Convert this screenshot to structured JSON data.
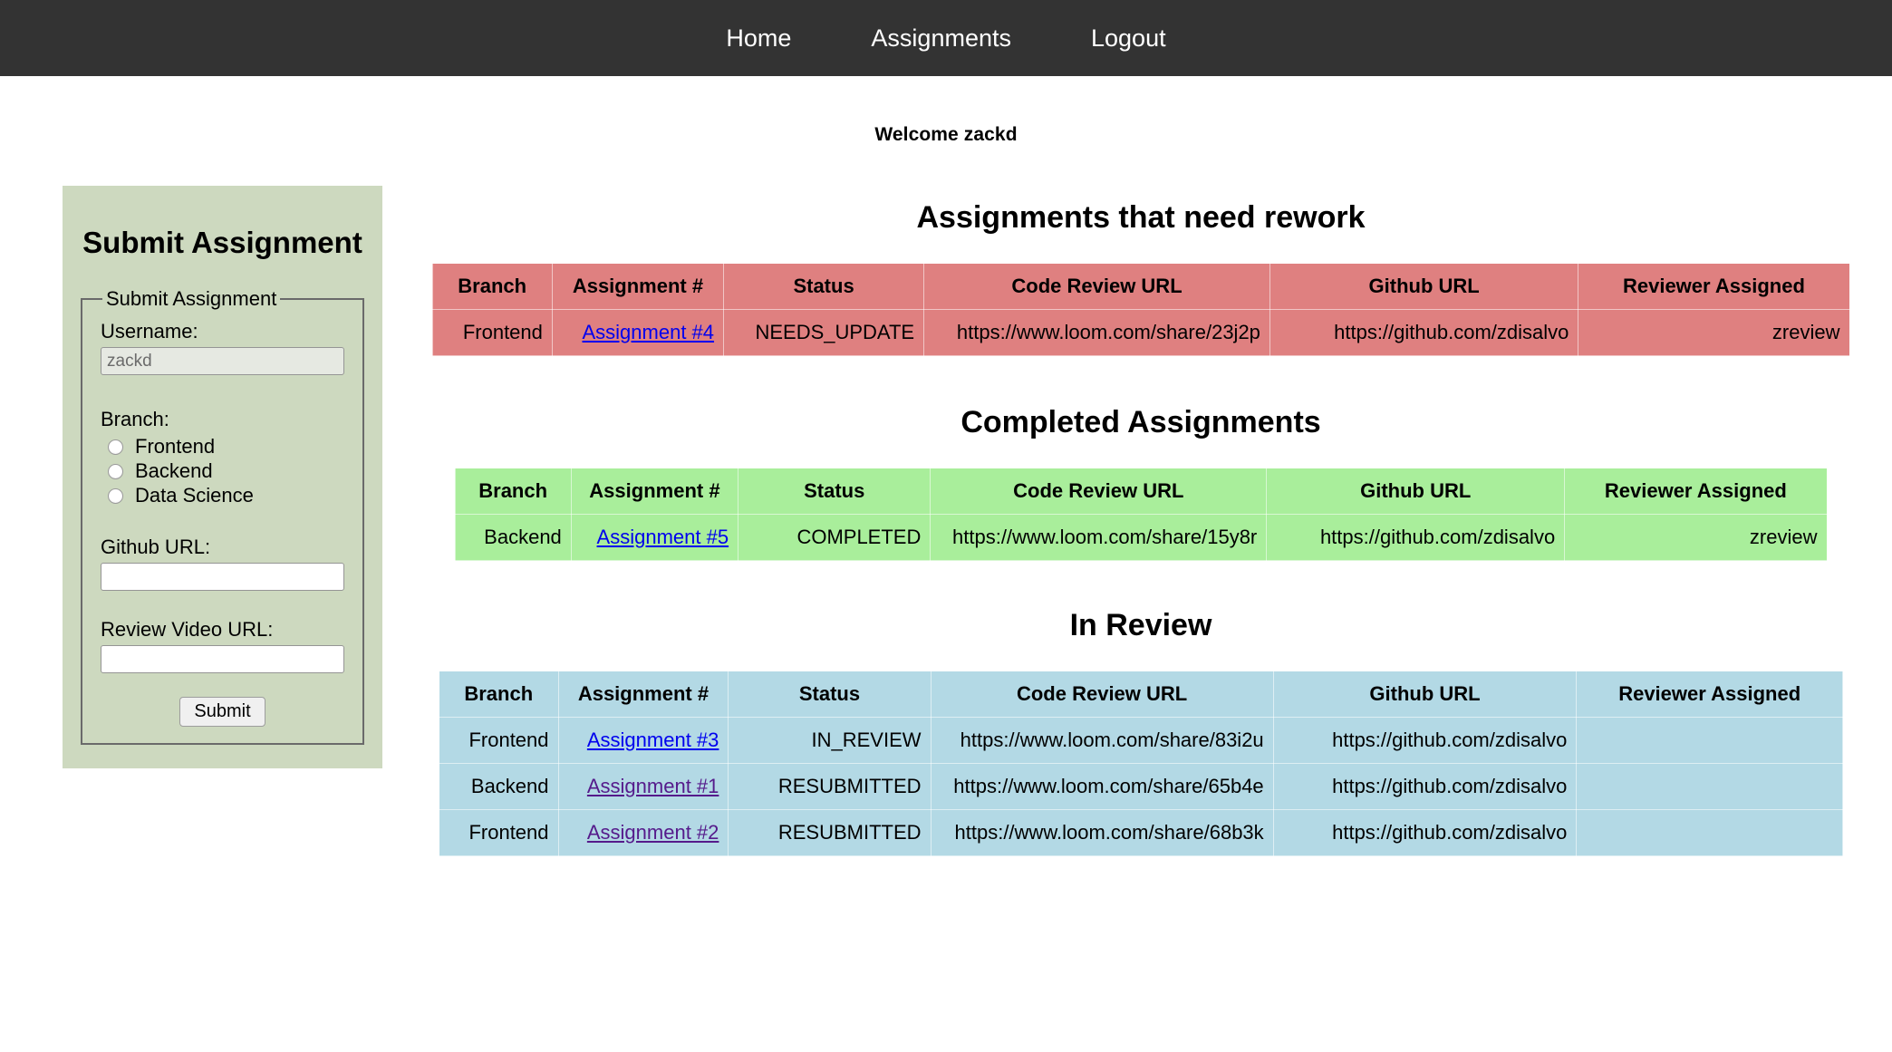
{
  "nav": {
    "items": [
      {
        "label": "Home",
        "name": "nav-link-home"
      },
      {
        "label": "Assignments",
        "name": "nav-link-assignments"
      },
      {
        "label": "Logout",
        "name": "nav-link-logout"
      }
    ]
  },
  "welcome": "Welcome zackd",
  "sidebar": {
    "title": "Submit Assignment",
    "legend": "Submit Assignment",
    "username_label": "Username:",
    "username_value": "zackd",
    "branch_label": "Branch:",
    "branch_options": [
      {
        "label": "Frontend",
        "selected": false
      },
      {
        "label": "Backend",
        "selected": false
      },
      {
        "label": "Data Science",
        "selected": false
      }
    ],
    "github_url_label": "Github URL:",
    "github_url_value": "",
    "review_video_url_label": "Review Video URL:",
    "review_video_url_value": "",
    "submit_label": "Submit"
  },
  "columns": [
    "Branch",
    "Assignment #",
    "Status",
    "Code Review URL",
    "Github URL",
    "Reviewer Assigned"
  ],
  "sections": [
    {
      "id": "rework",
      "title": "Assignments that need rework",
      "color": "#df8080",
      "rows": [
        {
          "branch": "Frontend",
          "assignment": "Assignment #4",
          "assignment_visited": false,
          "status": "NEEDS_UPDATE",
          "code_review_url": "https://www.loom.com/share/23j2p",
          "github_url": "https://github.com/zdisalvo",
          "reviewer": "zreview"
        }
      ]
    },
    {
      "id": "completed",
      "title": "Completed Assignments",
      "color": "#a9ee9b",
      "rows": [
        {
          "branch": "Backend",
          "assignment": "Assignment #5",
          "assignment_visited": false,
          "status": "COMPLETED",
          "code_review_url": "https://www.loom.com/share/15y8r",
          "github_url": "https://github.com/zdisalvo",
          "reviewer": "zreview"
        }
      ]
    },
    {
      "id": "in-review",
      "title": "In Review",
      "color": "#b3d9e5",
      "rows": [
        {
          "branch": "Frontend",
          "assignment": "Assignment #3",
          "assignment_visited": false,
          "status": "IN_REVIEW",
          "code_review_url": "https://www.loom.com/share/83i2u",
          "github_url": "https://github.com/zdisalvo",
          "reviewer": ""
        },
        {
          "branch": "Backend",
          "assignment": "Assignment #1",
          "assignment_visited": true,
          "status": "RESUBMITTED",
          "code_review_url": "https://www.loom.com/share/65b4e",
          "github_url": "https://github.com/zdisalvo",
          "reviewer": ""
        },
        {
          "branch": "Frontend",
          "assignment": "Assignment #2",
          "assignment_visited": true,
          "status": "RESUBMITTED",
          "code_review_url": "https://www.loom.com/share/68b3k",
          "github_url": "https://github.com/zdisalvo",
          "reviewer": ""
        }
      ]
    }
  ]
}
